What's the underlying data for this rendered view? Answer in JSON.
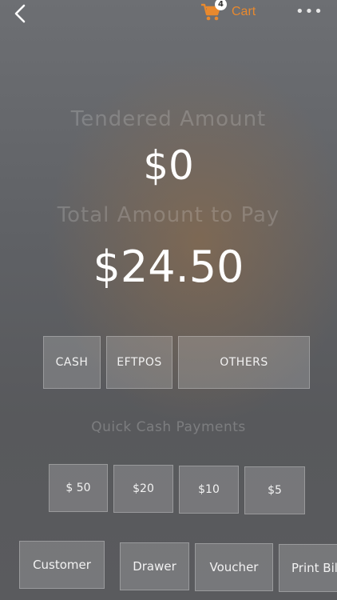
{
  "header": {
    "cart_label": "Cart",
    "cart_count": "4",
    "more_label": "•••",
    "accent_color": "#e8892e"
  },
  "amounts": {
    "tendered_label": "Tendered Amount",
    "tendered_value": "$0",
    "total_label": "Total Amount to Pay",
    "total_value": "$24.50"
  },
  "payment_methods": {
    "cash": "CASH",
    "eftpos": "EFTPOS",
    "others": "OTHERS"
  },
  "quick_cash": {
    "title": "Quick Cash Payments",
    "options": [
      "$ 50",
      "$20",
      "$10",
      "$5"
    ]
  },
  "actions": {
    "customer": "Customer",
    "drawer": "Drawer",
    "voucher": "Voucher",
    "print_bill": "Print Bill"
  }
}
